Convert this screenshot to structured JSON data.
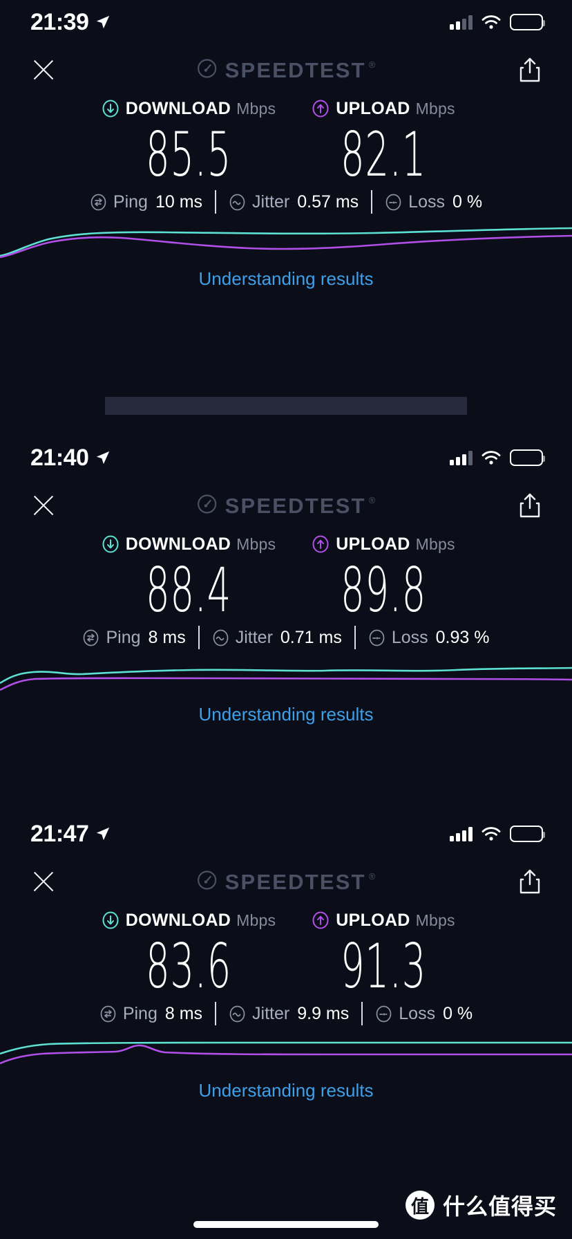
{
  "app": {
    "brand_name": "SPEEDTEST",
    "brand_trademark": "®",
    "close_label": "✕",
    "share_label": "share"
  },
  "icons": {
    "location_arrow": "location-arrow-icon",
    "cellular": "cellular-signal-icon",
    "wifi": "wifi-icon",
    "battery": "battery-icon",
    "close": "close-icon",
    "share": "share-icon",
    "speedtest_gauge": "gauge-icon",
    "download_arrow": "download-arrow-icon",
    "upload_arrow": "upload-arrow-icon",
    "ping": "ping-icon",
    "jitter": "jitter-icon",
    "loss": "loss-icon"
  },
  "colors": {
    "background": "#0b0e18",
    "download_accent": "#5ce1d3",
    "upload_accent": "#b14fe8",
    "link": "#3f9fe8",
    "brand_grey": "#4a5165",
    "stat_label": "#a7adbe",
    "separator": "#262a3c"
  },
  "shots": [
    {
      "status": {
        "time": "21:39",
        "signal_bars": 2,
        "total_bars": 4,
        "battery_percent": 100
      },
      "download": {
        "label": "DOWNLOAD",
        "unit": "Mbps",
        "value": "85.5"
      },
      "upload": {
        "label": "UPLOAD",
        "unit": "Mbps",
        "value": "82.1"
      },
      "stats": [
        {
          "name": "Ping",
          "value": "10 ms"
        },
        {
          "name": "Jitter",
          "value": "0.57 ms"
        },
        {
          "name": "Loss",
          "value": "0 %"
        }
      ],
      "footer_link": "Understanding results"
    },
    {
      "status": {
        "time": "21:40",
        "signal_bars": 3,
        "total_bars": 4,
        "battery_percent": 100
      },
      "download": {
        "label": "DOWNLOAD",
        "unit": "Mbps",
        "value": "88.4"
      },
      "upload": {
        "label": "UPLOAD",
        "unit": "Mbps",
        "value": "89.8"
      },
      "stats": [
        {
          "name": "Ping",
          "value": "8 ms"
        },
        {
          "name": "Jitter",
          "value": "0.71 ms"
        },
        {
          "name": "Loss",
          "value": "0.93 %"
        }
      ],
      "footer_link": "Understanding results"
    },
    {
      "status": {
        "time": "21:47",
        "signal_bars": 4,
        "total_bars": 4,
        "battery_percent": 100
      },
      "download": {
        "label": "DOWNLOAD",
        "unit": "Mbps",
        "value": "83.6"
      },
      "upload": {
        "label": "UPLOAD",
        "unit": "Mbps",
        "value": "91.3"
      },
      "stats": [
        {
          "name": "Ping",
          "value": "8 ms"
        },
        {
          "name": "Jitter",
          "value": "9.9 ms"
        },
        {
          "name": "Loss",
          "value": "0 %"
        }
      ],
      "footer_link": "Understanding results"
    }
  ],
  "watermark": {
    "logo_char": "值",
    "text": "什么值得买"
  },
  "chart_data": [
    {
      "type": "line",
      "title": "Speedtest throughput trace — 21:39",
      "xlabel": "",
      "ylabel": "Mbps",
      "grid": false,
      "legend": "none",
      "series": [
        {
          "name": "Download",
          "color": "#5ce1d3",
          "values": [
            0,
            28,
            62,
            74,
            78,
            79,
            80,
            81,
            82,
            83,
            84,
            85,
            85,
            86,
            86,
            86
          ]
        },
        {
          "name": "Upload",
          "color": "#b14fe8",
          "values": [
            0,
            22,
            52,
            70,
            66,
            58,
            52,
            48,
            47,
            50,
            56,
            62,
            68,
            74,
            78,
            80
          ]
        }
      ]
    },
    {
      "type": "line",
      "title": "Speedtest throughput trace — 21:40",
      "xlabel": "",
      "ylabel": "Mbps",
      "grid": false,
      "legend": "none",
      "series": [
        {
          "name": "Download",
          "color": "#5ce1d3",
          "values": [
            24,
            62,
            76,
            74,
            80,
            82,
            83,
            84,
            86,
            85,
            87,
            86,
            88,
            87,
            88,
            88
          ]
        },
        {
          "name": "Upload",
          "color": "#b14fe8",
          "values": [
            4,
            44,
            58,
            60,
            60,
            60,
            60,
            61,
            61,
            61,
            62,
            62,
            62,
            63,
            63,
            63
          ]
        }
      ]
    },
    {
      "type": "line",
      "title": "Speedtest throughput trace — 21:47",
      "xlabel": "",
      "ylabel": "Mbps",
      "grid": false,
      "legend": "none",
      "series": [
        {
          "name": "Download",
          "color": "#5ce1d3",
          "values": [
            56,
            74,
            80,
            82,
            83,
            83,
            84,
            84,
            84,
            84,
            84,
            84,
            84,
            84,
            84,
            84
          ]
        },
        {
          "name": "Upload",
          "color": "#b14fe8",
          "values": [
            20,
            48,
            56,
            58,
            72,
            60,
            58,
            58,
            58,
            58,
            58,
            58,
            58,
            58,
            58,
            58
          ]
        }
      ]
    }
  ]
}
